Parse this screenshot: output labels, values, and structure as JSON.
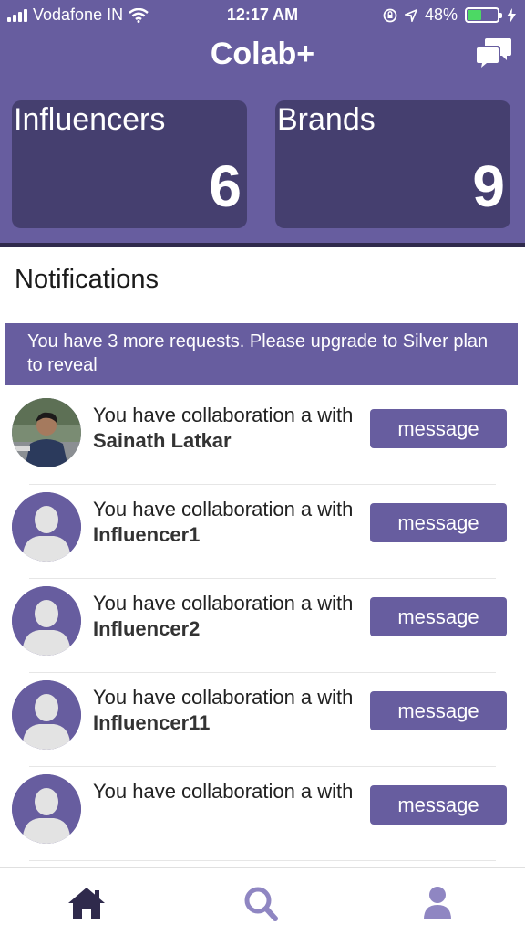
{
  "status_bar": {
    "carrier": "Vodafone IN",
    "time": "12:17 AM",
    "battery_percent": "48%",
    "battery_level": 0.48
  },
  "header": {
    "title": "Colab+",
    "chat_icon": "chat-bubbles-icon"
  },
  "stats": {
    "influencers": {
      "label": "Influencers",
      "value": "6"
    },
    "brands": {
      "label": "Brands",
      "value": "9"
    }
  },
  "notifications": {
    "title": "Notifications",
    "banner": "You have 3 more requests. Please upgrade to Silver plan to reveal",
    "items": [
      {
        "text": "You have collaboration a with ",
        "name": "Sainath Latkar",
        "button": "message",
        "avatar": "photo"
      },
      {
        "text": "You have collaboration a with ",
        "name": "Influencer1",
        "button": "message",
        "avatar": "placeholder"
      },
      {
        "text": "You have collaboration a with ",
        "name": "Influencer2",
        "button": "message",
        "avatar": "placeholder"
      },
      {
        "text": "You have collaboration a with ",
        "name": "Influencer11",
        "button": "message",
        "avatar": "placeholder"
      },
      {
        "text": "You have collaboration a with",
        "name": "",
        "button": "message",
        "avatar": "placeholder"
      }
    ]
  },
  "tabbar": {
    "tabs": [
      "home-icon",
      "search-icon",
      "profile-icon"
    ],
    "active_color": "#2f2a4c",
    "inactive_color": "#8f86c2"
  },
  "colors": {
    "primary": "#675d9f",
    "card": "#453f6f"
  }
}
